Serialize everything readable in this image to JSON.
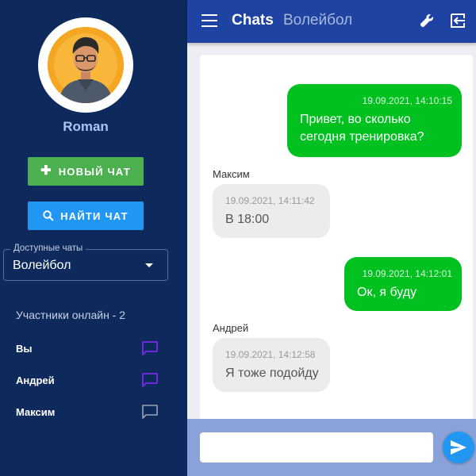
{
  "sidebar": {
    "username": "Roman",
    "new_chat_label": "НОВЫЙ ЧАТ",
    "find_chat_label": "НАЙТИ ЧАТ",
    "chat_select": {
      "legend": "Доступные чаты",
      "value": "Волейбол"
    },
    "online_title": "Участники онлайн - 2",
    "members": [
      {
        "name": "Вы",
        "icon": "chat-bubble-icon",
        "color": "#6b2bd9"
      },
      {
        "name": "Андрей",
        "icon": "chat-bubble-icon",
        "color": "#6b2bd9"
      },
      {
        "name": "Максим",
        "icon": "chat-bubble-outline-icon",
        "color": "#9aa3b5"
      }
    ]
  },
  "header": {
    "app_title": "Chats",
    "chat_name": "Волейбол"
  },
  "messages": [
    {
      "own": true,
      "sender": "",
      "timestamp": "19.09.2021, 14:10:15",
      "text": "Привет, во сколько сегодня тренировка?"
    },
    {
      "own": false,
      "sender": "Максим",
      "timestamp": "19.09.2021, 14:11:42",
      "text": "В 18:00"
    },
    {
      "own": true,
      "sender": "",
      "timestamp": "19.09.2021, 14:12:01",
      "text": "Ок, я буду"
    },
    {
      "own": false,
      "sender": "Андрей",
      "timestamp": "19.09.2021, 14:12:58",
      "text": "Я тоже подойду"
    }
  ],
  "composer": {
    "placeholder": ""
  },
  "colors": {
    "sidebar_bg": "#0e2a5c",
    "header_bg": "#1e43a2",
    "own_bubble": "#00c11f",
    "other_bubble": "#ececec",
    "new_chat_button": "#4caf50",
    "find_chat_button": "#2196f3",
    "send_button": "#2196f3"
  }
}
